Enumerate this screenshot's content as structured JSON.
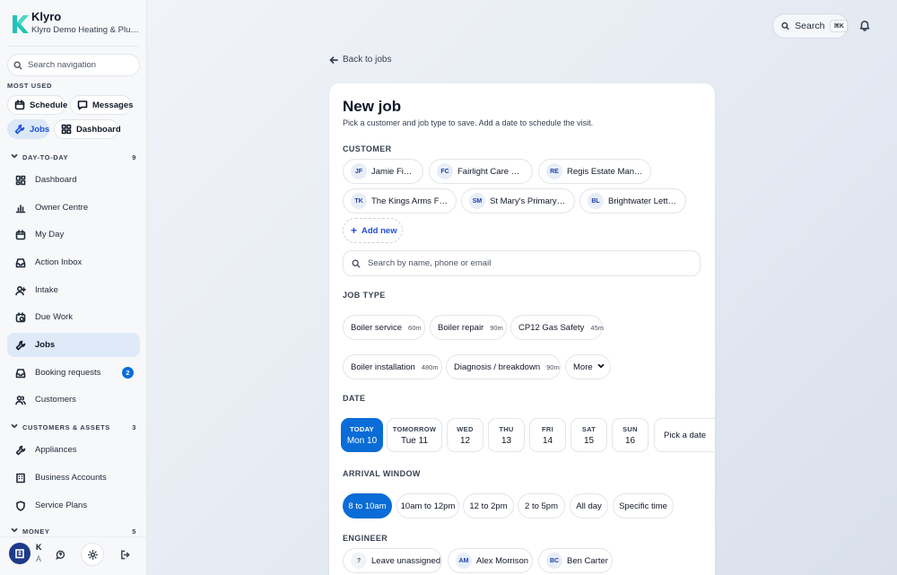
{
  "brand": {
    "name": "Klyro",
    "org": "Klyro Demo Heating & Plumbing"
  },
  "sidebar": {
    "search_placeholder": "Search navigation",
    "most_used_label": "MOST USED",
    "quick": [
      {
        "label": "Schedule",
        "icon": "calendar-icon"
      },
      {
        "label": "Messages",
        "icon": "message-icon"
      },
      {
        "label": "Jobs",
        "icon": "wrench-icon",
        "active": true
      },
      {
        "label": "Dashboard",
        "icon": "grid-icon"
      }
    ],
    "groups": [
      {
        "label": "DAY-TO-DAY",
        "count": "9"
      },
      {
        "label": "CUSTOMERS & ASSETS",
        "count": "3"
      },
      {
        "label": "MONEY",
        "count": "5"
      }
    ],
    "day_items": [
      {
        "label": "Dashboard",
        "icon": "grid-icon"
      },
      {
        "label": "Owner Centre",
        "icon": "bar-chart-icon"
      },
      {
        "label": "My Day",
        "icon": "calendar-icon"
      },
      {
        "label": "Action Inbox",
        "icon": "inbox-icon"
      },
      {
        "label": "Intake",
        "icon": "user-plus-icon"
      },
      {
        "label": "Due Work",
        "icon": "calendar-clock-icon"
      },
      {
        "label": "Jobs",
        "icon": "wrench-icon",
        "active": true
      },
      {
        "label": "Booking requests",
        "icon": "inbox-icon",
        "badge": "2"
      },
      {
        "label": "Customers",
        "icon": "users-icon"
      }
    ],
    "asset_items": [
      {
        "label": "Appliances",
        "icon": "wrench-icon"
      },
      {
        "label": "Business Accounts",
        "icon": "building-icon"
      },
      {
        "label": "Service Plans",
        "icon": "shield-icon"
      }
    ],
    "footer": {
      "initial": "K",
      "sub": "A"
    }
  },
  "topbar": {
    "search_label": "Search",
    "shortcut": "⌘K"
  },
  "back_label": "Back to jobs",
  "form": {
    "title": "New job",
    "subtitle": "Pick a customer and job type to save. Add a date to schedule the visit.",
    "customer_label": "CUSTOMER",
    "customers": [
      {
        "initials": "JF",
        "name": "Jamie Fixture"
      },
      {
        "initials": "FC",
        "name": "Fairlight Care Home"
      },
      {
        "initials": "RE",
        "name": "Regis Estate Manag..."
      },
      {
        "initials": "TK",
        "name": "The Kings Arms Fre..."
      },
      {
        "initials": "SM",
        "name": "St Mary's Primary S..."
      },
      {
        "initials": "BL",
        "name": "Brightwater Lettings"
      }
    ],
    "add_new_label": "Add new",
    "customer_search_placeholder": "Search by name, phone or email",
    "job_type_label": "JOB TYPE",
    "job_types": [
      {
        "name": "Boiler service",
        "duration": "60m"
      },
      {
        "name": "Boiler repair",
        "duration": "90m"
      },
      {
        "name": "CP12 Gas Safety",
        "duration": "45m"
      },
      {
        "name": "Boiler installation",
        "duration": "480m"
      },
      {
        "name": "Diagnosis / breakdown",
        "duration": "90m"
      }
    ],
    "more_label": "More",
    "date_label": "DATE",
    "dates": [
      {
        "day": "TODAY",
        "date": "Mon 10",
        "active": true
      },
      {
        "day": "TOMORROW",
        "date": "Tue 11"
      },
      {
        "day": "WED",
        "date": "12"
      },
      {
        "day": "THU",
        "date": "13"
      },
      {
        "day": "FRI",
        "date": "14"
      },
      {
        "day": "SAT",
        "date": "15"
      },
      {
        "day": "SUN",
        "date": "16"
      }
    ],
    "pick_date_label": "Pick a date",
    "arrival_label": "ARRIVAL WINDOW",
    "arrival_windows": [
      "8 to 10am",
      "10am to 12pm",
      "12 to 2pm",
      "2 to 5pm",
      "All day",
      "Specific time"
    ],
    "engineer_label": "ENGINEER",
    "engineers": [
      {
        "initials": "?",
        "name": "Leave unassigned"
      },
      {
        "initials": "AM",
        "name": "Alex Morrison"
      },
      {
        "initials": "BC",
        "name": "Ben Carter"
      }
    ]
  },
  "colors": {
    "accent": "#0a6cd6",
    "active_bg": "#dfeaf8"
  }
}
